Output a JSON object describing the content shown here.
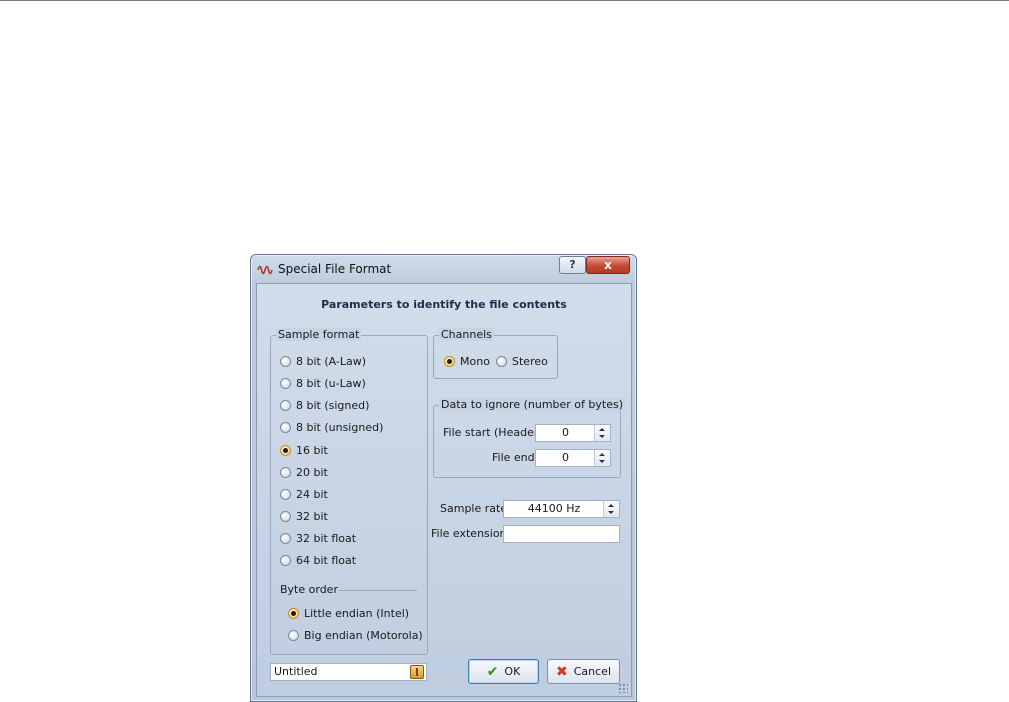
{
  "dialog": {
    "title": "Special File Format",
    "help_button": "?",
    "close_button": "x",
    "heading": "Parameters to identify the file contents"
  },
  "sample_format": {
    "label": "Sample format",
    "options": [
      "8 bit (A-Law)",
      "8 bit (u-Law)",
      "8 bit (signed)",
      "8 bit (unsigned)",
      "16 bit",
      "20 bit",
      "24 bit",
      "32 bit",
      "32 bit float",
      "64 bit float"
    ],
    "selected": "16 bit"
  },
  "byte_order": {
    "label": "Byte order",
    "options": [
      "Little endian (Intel)",
      "Big endian (Motorola)"
    ],
    "selected": "Little endian (Intel)"
  },
  "channels": {
    "label": "Channels",
    "options": [
      "Mono",
      "Stereo"
    ],
    "selected": "Mono"
  },
  "data_to_ignore": {
    "label": "Data to ignore (number of bytes)",
    "file_start_label": "File start (Header)",
    "file_start_value": "0",
    "file_end_label": "File end",
    "file_end_value": "0"
  },
  "sample_rate": {
    "label": "Sample rate",
    "value": "44100 Hz"
  },
  "file_extension": {
    "label": "File extension",
    "value": ""
  },
  "preset": {
    "value": "Untitled"
  },
  "buttons": {
    "ok": "OK",
    "cancel": "Cancel"
  },
  "colors": {
    "dialog_bg": "#bccbdc",
    "close_red": "#c44a34",
    "accent_border": "#3c7fb1"
  }
}
